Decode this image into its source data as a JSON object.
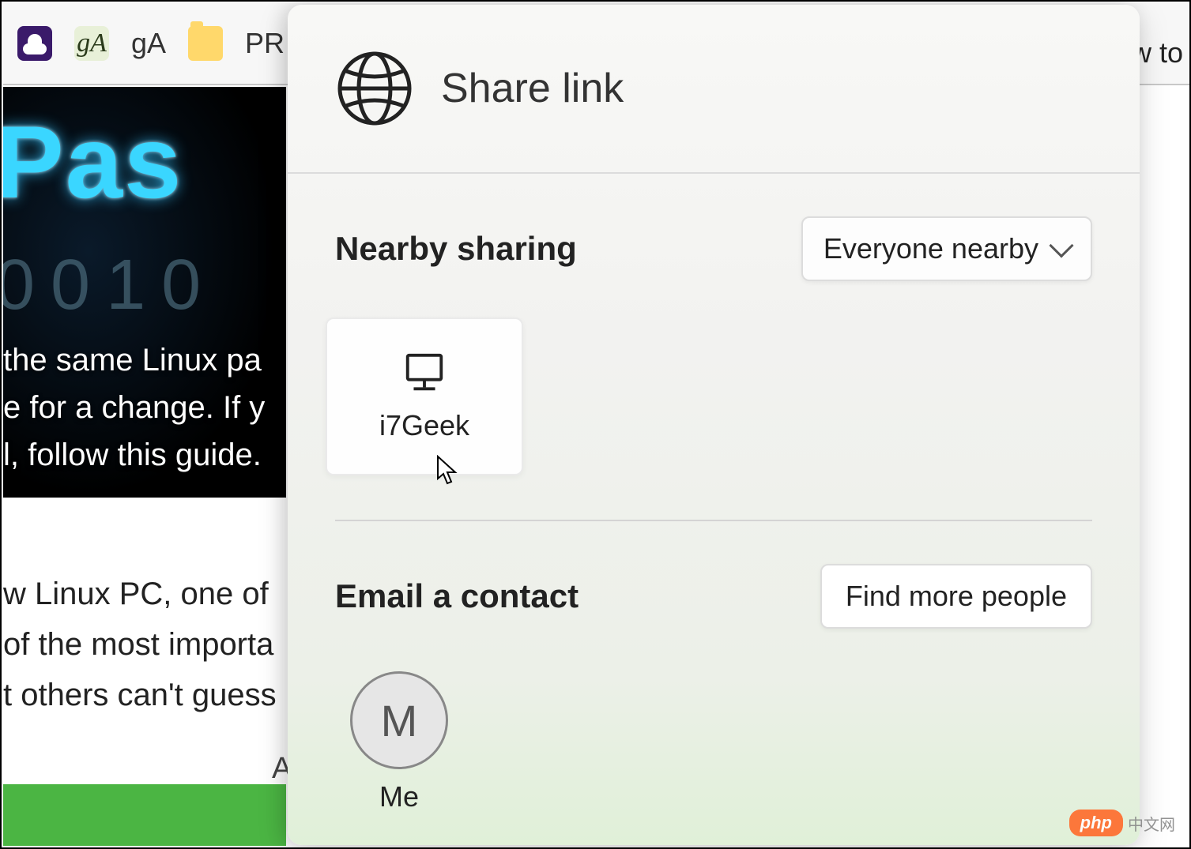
{
  "toolbar": {
    "bookmarks": [
      {
        "label": "",
        "icon": "user-badge"
      },
      {
        "label": "gA",
        "icon": "ga-script"
      },
      {
        "label": "gA",
        "icon": "text"
      },
      {
        "label": "PR",
        "icon": "folder"
      }
    ],
    "truncated_tab_right": "w to"
  },
  "background_article": {
    "hero_word_fragment": "Pas",
    "hero_binary_fragment": "0010",
    "hero_caption_lines": [
      " the same Linux pa",
      "e for a change. If y",
      "l, follow this guide."
    ],
    "body_lines": [
      "w Linux PC, one of",
      "of the most importa",
      "t others can't guess"
    ],
    "trailing_char": "A"
  },
  "share_dialog": {
    "title": "Share link",
    "nearby": {
      "heading": "Nearby sharing",
      "dropdown_selected": "Everyone nearby",
      "devices": [
        {
          "name": "i7Geek",
          "icon": "desktop"
        }
      ]
    },
    "email": {
      "heading": "Email a contact",
      "find_more_label": "Find more people",
      "contacts": [
        {
          "initial": "M",
          "label": "Me"
        }
      ]
    }
  },
  "watermark": {
    "brand": "php",
    "suffix": "中文网"
  }
}
